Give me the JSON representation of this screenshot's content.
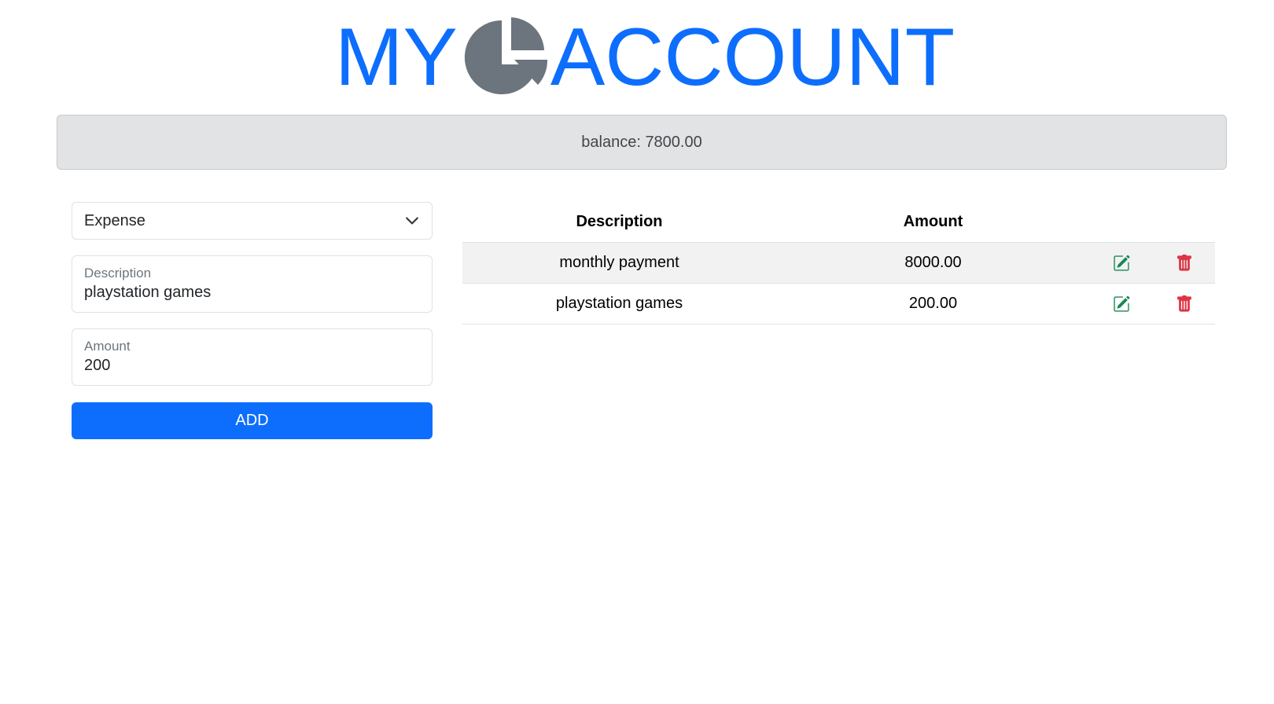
{
  "header": {
    "title_left": "MY",
    "title_right": "ACCOUNT",
    "logo_icon": "pie-chart-icon",
    "title_color": "#0d6efd",
    "icon_color": "#6c757d"
  },
  "balance": {
    "text": "balance: 7800.00"
  },
  "form": {
    "type_select": {
      "selected": "Expense"
    },
    "description": {
      "label": "Description",
      "value": "playstation games"
    },
    "amount": {
      "label": "Amount",
      "value": "200"
    },
    "add_label": "ADD"
  },
  "table": {
    "headers": {
      "description": "Description",
      "amount": "Amount"
    },
    "rows": [
      {
        "description": "monthly payment",
        "amount": "8000.00"
      },
      {
        "description": "playstation games",
        "amount": "200.00"
      }
    ],
    "edit_icon": "edit-icon",
    "delete_icon": "trash-icon",
    "edit_color": "#198754",
    "delete_color": "#dc3545"
  }
}
